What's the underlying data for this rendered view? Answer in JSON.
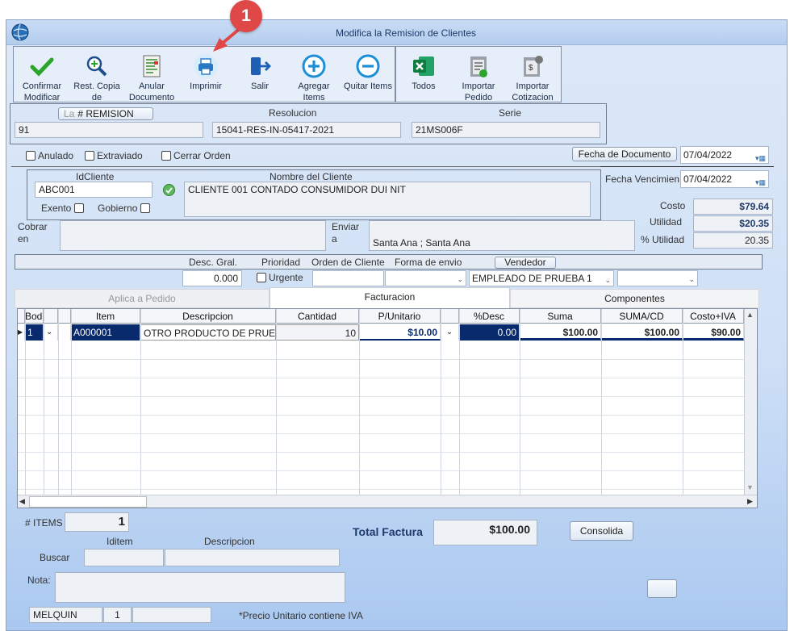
{
  "annotation": {
    "number": "1"
  },
  "window": {
    "title": "Modifica la Remision de Clientes"
  },
  "toolbar": {
    "confirm": "Confirmar Modificar",
    "restore": "Rest. Copia de",
    "cancel": "Anular Documento",
    "print": "Imprimir",
    "exit": "Salir",
    "add": "Agregar Items",
    "remove": "Quitar Items",
    "all": "Todos",
    "import_order": "Importar Pedido",
    "import_quote": "Importar Cotizacion"
  },
  "header": {
    "remision_label": "# REMISION",
    "remision_overlay": "La",
    "remision": "91",
    "resolucion_label": "Resolucion",
    "resolucion": "15041-RES-IN-05417-2021",
    "serie_label": "Serie",
    "serie": "21MS006F"
  },
  "flags": {
    "anulado": "Anulado",
    "extraviado": "Extraviado",
    "cerrar": "Cerrar Orden"
  },
  "dates": {
    "fecha_doc_label": "Fecha de  Documento",
    "fecha_doc": "07/04/2022",
    "fecha_venc_label": "Fecha Vencimien",
    "fecha_venc": "07/04/2022"
  },
  "client": {
    "id_label": "IdCliente",
    "id": "ABC001",
    "name_label": "Nombre del Cliente",
    "name": "CLIENTE 001 CONTADO CONSUMIDOR DUI NIT",
    "exento": "Exento",
    "gobierno": "Gobierno",
    "cobrar_label": "Cobrar en",
    "enviar_label": "Enviar a",
    "enviar": "Santa Ana ; Santa Ana"
  },
  "totals_side": {
    "costo_label": "Costo",
    "costo": "$79.64",
    "utilidad_label": "Utilidad",
    "utilidad": "$20.35",
    "pct_label": "% Utilidad",
    "pct": "20.35"
  },
  "order": {
    "desc_label": "Desc. Gral.",
    "desc": "0.000",
    "prioridad_label": "Prioridad",
    "urgente": "Urgente",
    "orden_label": "Orden de Cliente",
    "forma_label": "Forma de envio",
    "vendedor_label": "Vendedor",
    "vendedor": "EMPLEADO DE PRUEBA 1"
  },
  "tabs": [
    "Aplica a Pedido",
    "Facturacion",
    "Componentes"
  ],
  "grid": {
    "columns": [
      "Bodega",
      "",
      "",
      "Item",
      "Descripcion",
      "Cantidad",
      "P/Unitario",
      "",
      "%Desc",
      "Suma",
      "SUMA/CD",
      "Costo+IVA"
    ],
    "row": {
      "bodega": "1",
      "item": "A000001",
      "desc": "OTRO PRODUCTO DE PRUEBA",
      "cantidad": "10",
      "punit": "$10.00",
      "pdesc": "0.00",
      "suma": "$100.00",
      "sumacd": "$100.00",
      "costo": "$90.00"
    }
  },
  "footer": {
    "items_label": "# ITEMS",
    "items": "1",
    "total_label": "Total Factura",
    "total": "$100.00",
    "consolida": "Consolida",
    "iditem_label": "Iditem",
    "descripcion_label": "Descripcion",
    "buscar_label": "Buscar",
    "nota_label": "Nota:",
    "user": "MELQUIN",
    "user_num": "1",
    "note": "*Precio Unitario contiene IVA"
  },
  "colors": {
    "accent": "#0a2a6e",
    "annotation": "#e04848"
  }
}
